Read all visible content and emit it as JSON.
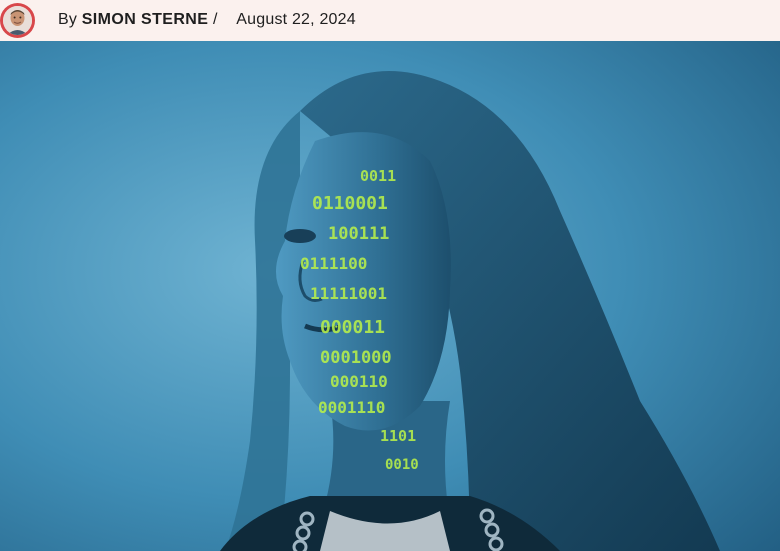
{
  "byline": {
    "prefix": "By",
    "author": "SIMON STERNE",
    "separator": "/",
    "date": "August 22, 2024"
  },
  "avatar": {
    "icon": "author-avatar"
  },
  "hero_image": {
    "subject": "woman-face-with-binary-code-projection",
    "accent_color": "#b8f04a",
    "background_color": "#3a82aa"
  },
  "binary_overlay_rows": [
    "0011",
    "0110001",
    "100111",
    "0111100",
    "11111001",
    "000011",
    "0001000",
    "000110",
    "0001110",
    "1101",
    "0010"
  ]
}
